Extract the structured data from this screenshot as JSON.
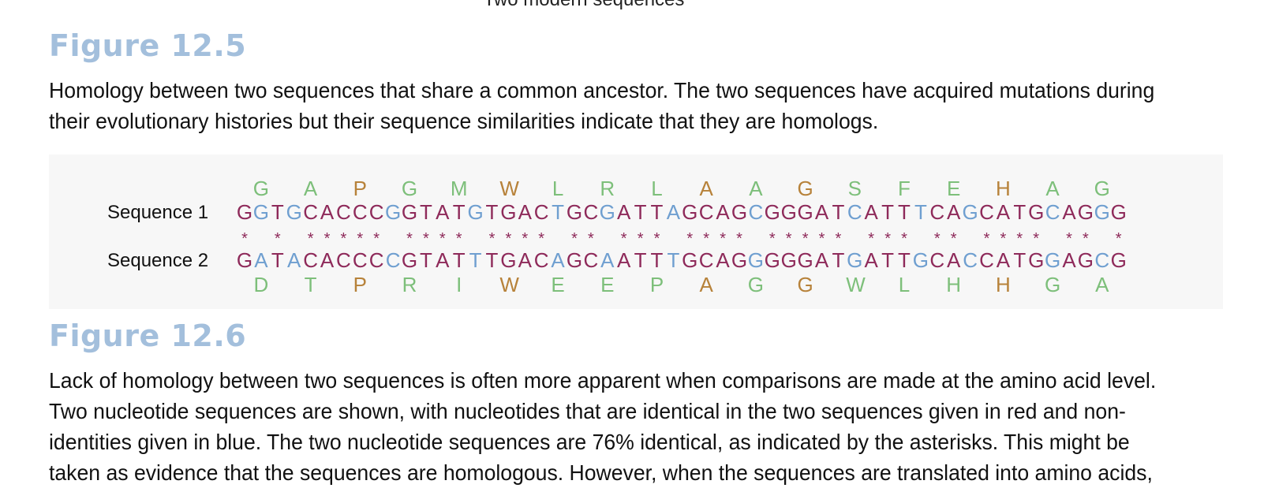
{
  "top_caption": "Two modern sequences",
  "fig1": {
    "title": "Figure 12.5",
    "text_lines": [
      "Homology between two sequences that share a common ancestor. The two sequences have acquired mutations during",
      "their evolutionary histories but their sequence similarities indicate that they are homologs."
    ]
  },
  "alignment": {
    "seq1_label": "Sequence 1",
    "seq2_label": "Sequence 2",
    "aa1": "GAPGMWLRLAAGSFEHAG",
    "seq1": "GGTGCACCCGGTATGTGACTGCGATTAGCAGCGGGATCATTTCAGCATGCAGGG",
    "match": "* ***** **** **** ** *** **** ***** *** ** **** ** *",
    "seq2": "GATACACCCCGTATTTGACAGCAATTTGCAGGGGGATGATTGCACCATGGAGCG",
    "aa2": "DTPRIWEEPAGGWLHHGA",
    "aa1_colors": [
      "green",
      "green",
      "olive",
      "green",
      "green",
      "olive",
      "green",
      "green",
      "green",
      "olive",
      "green",
      "olive",
      "green",
      "green",
      "green",
      "olive",
      "green",
      "green"
    ],
    "aa2_colors": [
      "green",
      "green",
      "olive",
      "green",
      "green",
      "olive",
      "green",
      "green",
      "green",
      "olive",
      "green",
      "olive",
      "green",
      "green",
      "green",
      "olive",
      "green",
      "green"
    ],
    "colors": {
      "identical": "#8e2a5a",
      "nonidentical": "#6f9fd0",
      "green": "#7dbf7a",
      "olive": "#b7823a"
    }
  },
  "fig2": {
    "title": "Figure 12.6",
    "text_lines": [
      "Lack of homology between two sequences is often more apparent when comparisons are made at the amino acid level.",
      "Two nucleotide sequences are shown, with nucleotides that are identical in the two sequences given in red and non-",
      "identities given in blue. The two nucleotide sequences are 76% identical, as indicated by the asterisks. This might be",
      "taken as evidence that the sequences are homologous. However, when the sequences are translated into amino acids,"
    ]
  }
}
